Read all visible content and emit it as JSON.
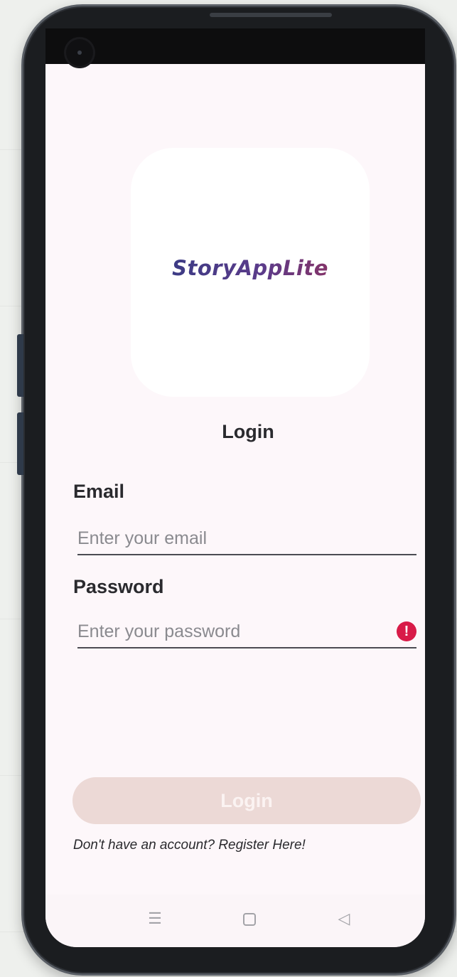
{
  "app": {
    "logo_text": "StoryAppLite",
    "screen_title": "Login"
  },
  "form": {
    "email": {
      "label": "Email",
      "placeholder": "Enter your email",
      "value": ""
    },
    "password": {
      "label": "Password",
      "placeholder": "Enter your password",
      "value": "",
      "error_icon": "error-icon"
    },
    "submit_label": "Login",
    "register_prompt": "Don't have an account? Register Here!"
  },
  "colors": {
    "screen_background": "#fdf7fa",
    "button_disabled": "#ecd9d6",
    "error": "#d81b48",
    "logo_gradient_start": "#2e3b82",
    "logo_gradient_end": "#9c2f55"
  },
  "navigation": {
    "menu_icon": "menu-icon",
    "home_icon": "home-icon",
    "back_icon": "back-icon"
  }
}
